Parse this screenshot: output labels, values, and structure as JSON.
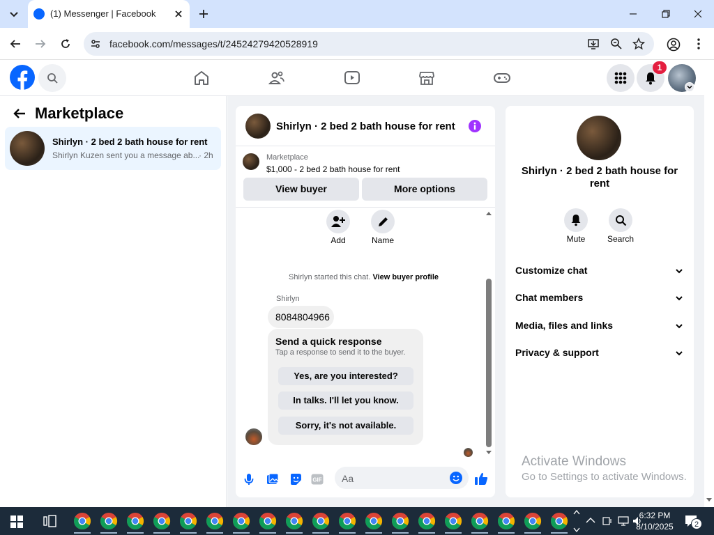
{
  "browser": {
    "tab_title": "(1) Messenger | Facebook",
    "url": "facebook.com/messages/t/24524279420528919"
  },
  "header": {
    "notification_count": "1"
  },
  "left": {
    "title": "Marketplace",
    "conversation": {
      "name": "Shirlyn · 2 bed 2 bath house for rent",
      "preview": "Shirlyn Kuzen sent you a message ab...",
      "time": "· 2h"
    }
  },
  "chat": {
    "header_name": "Shirlyn · 2 bed 2 bath house for rent",
    "listing_label": "Marketplace",
    "listing_price": "$1,000 - 2 bed 2 bath house for rent",
    "view_buyer": "View buyer",
    "more_options": "More options",
    "add_label": "Add",
    "name_label": "Name",
    "started_text": "Shirlyn started this chat.",
    "view_profile": "View buyer profile",
    "sender": "Shirlyn",
    "message": "8084804966",
    "quick_title": "Send a quick response",
    "quick_sub": "Tap a response to send it to the buyer.",
    "quick_replies": [
      "Yes, are you interested?",
      "In talks. I'll let you know.",
      "Sorry, it's not available."
    ],
    "input_placeholder": "Aa"
  },
  "info": {
    "name": "Shirlyn · 2 bed 2 bath house for rent",
    "mute": "Mute",
    "search": "Search",
    "sections": [
      "Customize chat",
      "Chat members",
      "Media, files and links",
      "Privacy & support"
    ]
  },
  "watermark": {
    "line1": "Activate Windows",
    "line2": "Go to Settings to activate Windows."
  },
  "taskbar": {
    "time": "6:32 PM",
    "date": "8/10/2025",
    "notif_count": "2"
  },
  "colors": {
    "fb_blue": "#0866ff",
    "messenger_purple": "#a033ff"
  }
}
